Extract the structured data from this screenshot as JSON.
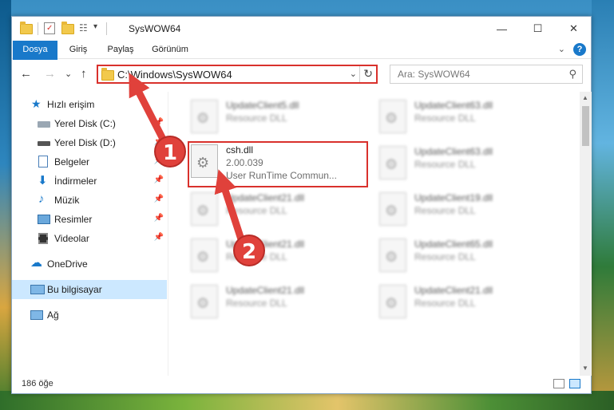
{
  "window": {
    "title": "SysWOW64",
    "minimize_glyph": "—",
    "maximize_glyph": "☐",
    "close_glyph": "✕"
  },
  "quick_access_toolbar": {
    "dropdown_glyph": "▾"
  },
  "ribbon": {
    "tabs": [
      {
        "label": "Dosya"
      },
      {
        "label": "Giriş"
      },
      {
        "label": "Paylaş"
      },
      {
        "label": "Görünüm"
      }
    ],
    "help_glyph": "?",
    "collapse_glyph": "⌄"
  },
  "navigation": {
    "back_glyph": "←",
    "forward_glyph": "→",
    "recent_glyph": "⌄",
    "up_glyph": "↑",
    "address": "C:\\Windows\\SysWOW64",
    "address_dropdown_glyph": "⌄",
    "refresh_glyph": "↻",
    "search_placeholder": "Ara: SysWOW64",
    "search_glyph": "⚲"
  },
  "sidebar": {
    "items": [
      {
        "label": "Hızlı erişim",
        "icon": "star-icon",
        "pinned": false
      },
      {
        "label": "Yerel Disk (C:)",
        "icon": "drive-icon",
        "pinned": true
      },
      {
        "label": "Yerel Disk (D:)",
        "icon": "drive-icon",
        "pinned": true
      },
      {
        "label": "Belgeler",
        "icon": "documents-icon",
        "pinned": true
      },
      {
        "label": "İndirmeler",
        "icon": "download-icon",
        "pinned": true
      },
      {
        "label": "Müzik",
        "icon": "music-icon",
        "pinned": true
      },
      {
        "label": "Resimler",
        "icon": "pictures-icon",
        "pinned": true
      },
      {
        "label": "Videolar",
        "icon": "video-icon",
        "pinned": true
      },
      {
        "label": "OneDrive",
        "icon": "cloud-icon",
        "pinned": false
      },
      {
        "label": "Bu bilgisayar",
        "icon": "computer-icon",
        "pinned": false,
        "selected": true
      },
      {
        "label": "Ağ",
        "icon": "network-icon",
        "pinned": false
      }
    ],
    "pin_glyph": "📌"
  },
  "files": {
    "left_column": [
      {
        "name": "UpdateClient5.dll",
        "type": "Resource DLL"
      },
      {
        "name": "csh.dll",
        "version": "2.00.039",
        "description": "User RunTime Commun...",
        "highlighted": true
      },
      {
        "name": "UpdateClient21.dll",
        "type": "Resource DLL"
      },
      {
        "name": "UpdateClient21.dll",
        "type": "Resource DLL"
      },
      {
        "name": "UpdateClient21.dll",
        "type": "Resource DLL"
      }
    ],
    "right_column": [
      {
        "name": "UpdateClient63.dll",
        "type": "Resource DLL"
      },
      {
        "name": "UpdateClient63.dll",
        "type": "Resource DLL"
      },
      {
        "name": "UpdateClient19.dll",
        "type": "Resource DLL"
      },
      {
        "name": "UpdateClient65.dll",
        "type": "Resource DLL"
      },
      {
        "name": "UpdateClient21.dll",
        "type": "Resource DLL"
      }
    ]
  },
  "scrollbar": {
    "up_glyph": "▲",
    "down_glyph": "▼"
  },
  "status_bar": {
    "item_count": "186 öğe"
  },
  "annotations": [
    {
      "label": "1"
    },
    {
      "label": "2"
    }
  ],
  "colors": {
    "accent": "#1979ca",
    "highlight": "#d9312c",
    "annotation": "#e0413b",
    "selected_nav": "#cce8ff"
  }
}
